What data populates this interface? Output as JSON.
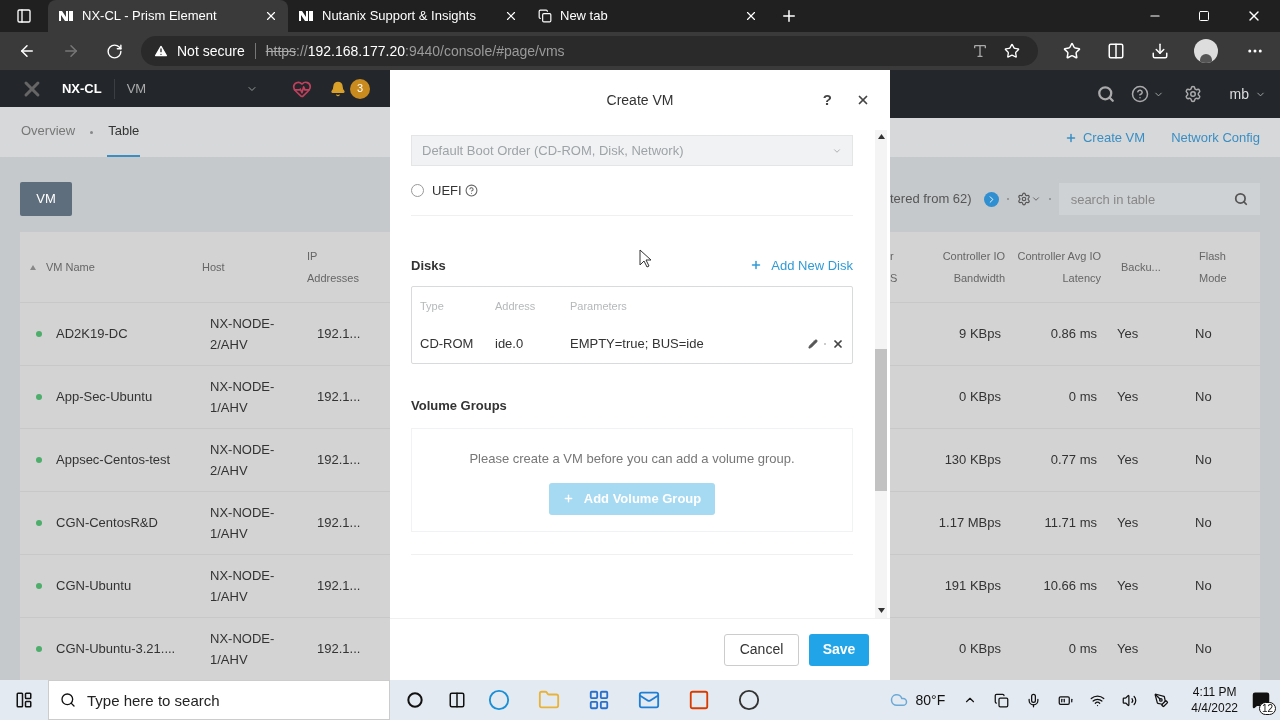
{
  "browser": {
    "tabs": [
      {
        "title": "NX-CL - Prism Element",
        "selected": true,
        "kind": "nutanix"
      },
      {
        "title": "Nutanix Support & Insights",
        "selected": false,
        "kind": "nutanix"
      },
      {
        "title": "New tab",
        "selected": false,
        "kind": "newtab"
      }
    ],
    "address": {
      "security": "Not secure",
      "url_parts": [
        {
          "kind": "scheme",
          "text": "https"
        },
        {
          "kind": "dim",
          "text": "://"
        },
        {
          "kind": "host",
          "text": "192.168.177.20"
        },
        {
          "kind": "dim",
          "text": ":9440/console/#page/vms"
        }
      ]
    }
  },
  "app_header": {
    "cluster": "NX-CL",
    "section": "VM",
    "alert_count": "3",
    "user": "mb"
  },
  "subnav": {
    "tabs": [
      {
        "label": "Overview",
        "selected": false
      },
      {
        "label": "Table",
        "selected": true
      }
    ],
    "actions": [
      {
        "label": "Create VM",
        "kind": "add"
      },
      {
        "label": "Network Config",
        "kind": "plain"
      }
    ]
  },
  "toolbar": {
    "view_button": "VM",
    "filter_text": "tered from 62)",
    "search": {
      "placeholder": "search in table"
    }
  },
  "table": {
    "left_columns": [
      "VM Name",
      "Host",
      "IP Addresses"
    ],
    "cut_header": "r S",
    "right_columns": [
      "Controller IO Bandwidth",
      "Controller Avg IO Latency",
      "Backu...",
      "Flash Mode"
    ],
    "rows": [
      {
        "color": "#4cae6a",
        "name": "AD2K19-DC",
        "host": "NX-NODE-2/AHV",
        "ip": "192.1...",
        "bandwidth": "9 KBps",
        "latency": "0.86 ms",
        "backup": "Yes",
        "flash": "No"
      },
      {
        "color": "#4cae6a",
        "name": "App-Sec-Ubuntu",
        "host": "NX-NODE-1/AHV",
        "ip": "192.1...",
        "bandwidth": "0 KBps",
        "latency": "0 ms",
        "backup": "Yes",
        "flash": "No"
      },
      {
        "color": "#4cae6a",
        "name": "Appsec-Centos-test",
        "host": "NX-NODE-2/AHV",
        "ip": "192.1...",
        "bandwidth": "130 KBps",
        "latency": "0.77 ms",
        "backup": "Yes",
        "flash": "No"
      },
      {
        "color": "#4cae6a",
        "name": "CGN-CentosR&D",
        "host": "NX-NODE-1/AHV",
        "ip": "192.1...",
        "bandwidth": "1.17 MBps",
        "latency": "11.71 ms",
        "backup": "Yes",
        "flash": "No"
      },
      {
        "color": "#4cae6a",
        "name": "CGN-Ubuntu",
        "host": "NX-NODE-1/AHV",
        "ip": "192.1...",
        "bandwidth": "191 KBps",
        "latency": "10.66 ms",
        "backup": "Yes",
        "flash": "No"
      },
      {
        "color": "#4cae6a",
        "name": "CGN-Ubuntu-3.21....",
        "host": "NX-NODE-1/AHV",
        "ip": "192.1...",
        "bandwidth": "0 KBps",
        "latency": "0 ms",
        "backup": "Yes",
        "flash": "No"
      }
    ]
  },
  "modal": {
    "title": "Create VM",
    "help": "?",
    "boot_select": {
      "value": "Default Boot Order (CD-ROM, Disk, Network)",
      "disabled": true
    },
    "uefi": {
      "label": "UEFI",
      "checked": false
    },
    "disks": {
      "heading": "Disks",
      "add_label": "Add New Disk",
      "columns": [
        "Type",
        "Address",
        "Parameters"
      ],
      "rows": [
        {
          "type": "CD-ROM",
          "address": "ide.0",
          "parameters": "EMPTY=true; BUS=ide"
        }
      ]
    },
    "volume_groups": {
      "heading": "Volume Groups",
      "message": "Please create a VM before you can add a volume group.",
      "add_button": {
        "label": "Add Volume Group",
        "disabled": true
      }
    },
    "buttons": [
      {
        "label": "Cancel",
        "kind": "secondary"
      },
      {
        "label": "Save",
        "kind": "primary"
      }
    ]
  },
  "taskbar": {
    "search_placeholder": "Type here to search",
    "weather": "80°F",
    "time": "4:11 PM",
    "date": "4/4/2022",
    "notifications": "12"
  }
}
